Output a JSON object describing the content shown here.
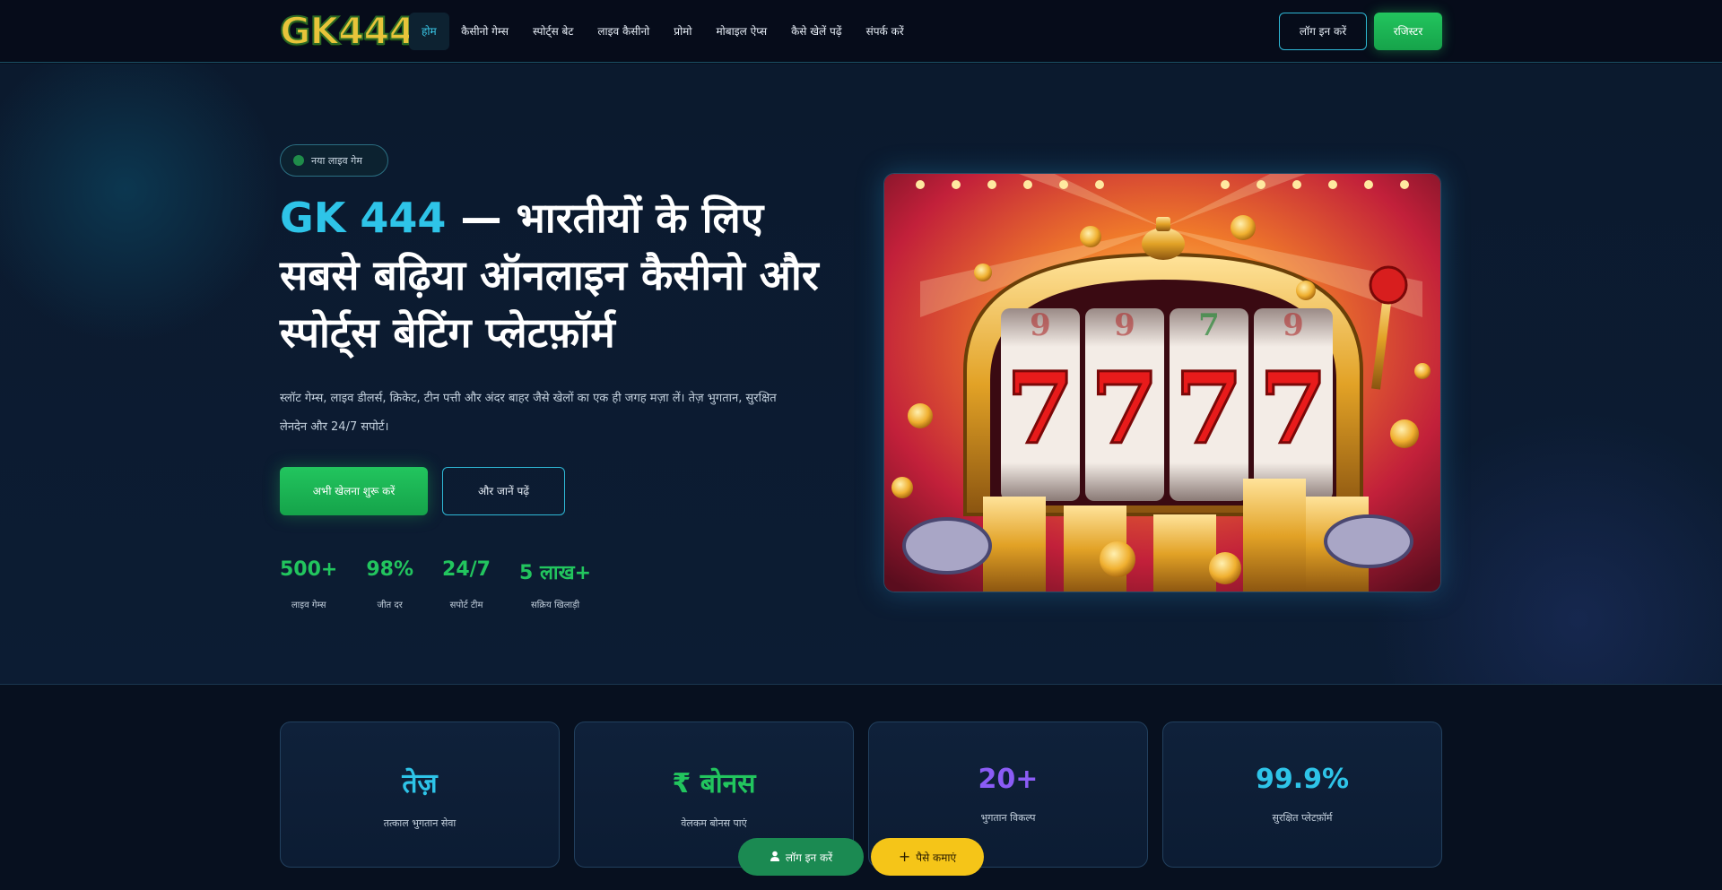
{
  "logo": {
    "text": "GK444"
  },
  "nav": {
    "items": [
      {
        "label": "होम",
        "active": true
      },
      {
        "label": "कैसीनो गेम्स"
      },
      {
        "label": "स्पोर्ट्स बेट"
      },
      {
        "label": "लाइव कैसीनो"
      },
      {
        "label": "प्रोमो"
      },
      {
        "label": "मोबाइल ऐप्स"
      },
      {
        "label": "कैसे खेलें पढ़ें"
      },
      {
        "label": "संपर्क करें"
      }
    ],
    "login_label": "लॉग इन करें",
    "register_label": "रजिस्टर"
  },
  "hero": {
    "badge": "नया लाइव गेम",
    "title_brand": "GK 444",
    "title_rest": " — भारतीयों के लिए सबसे बढ़िया ऑनलाइन कैसीनो और स्पोर्ट्स बेटिंग प्लेटफ़ॉर्म",
    "description": "स्लॉट गेम्स, लाइव डीलर्स, क्रिकेट, टीन पत्ती और अंदर बाहर जैसे खेलों का एक ही जगह मज़ा लें। तेज़ भुगतान, सुरक्षित लेनदेन और 24/7 सपोर्ट।",
    "cta_primary": "अभी खेलना शुरू करें",
    "cta_secondary": "और जानें पढ़ें",
    "stats": [
      {
        "value": "500+",
        "label": "लाइव गेम्स"
      },
      {
        "value": "98%",
        "label": "जीत दर"
      },
      {
        "value": "24/7",
        "label": "सपोर्ट टीम"
      },
      {
        "value": "5 लाख+",
        "label": "सक्रिय खिलाड़ी"
      }
    ]
  },
  "features": [
    {
      "value": "तेज़",
      "label": "तत्काल भुगतान सेवा",
      "color": "#2ec4e8"
    },
    {
      "value": "₹ बोनस",
      "label": "वेलकम बोनस पाएं",
      "color": "#22c55e"
    },
    {
      "value": "20+",
      "label": "भुगतान विकल्प",
      "color": "#8b5cf6"
    },
    {
      "value": "99.9%",
      "label": "सुरक्षित प्लेटफ़ॉर्म",
      "color": "#2ec4e8"
    }
  ],
  "floating": {
    "login_label": "लॉग इन करें",
    "register_label": "पैसे कमाएं"
  },
  "colors": {
    "accent": "#2ec4e8",
    "green": "#22c55e",
    "yellow": "#f5c518",
    "background": "#07101f"
  }
}
